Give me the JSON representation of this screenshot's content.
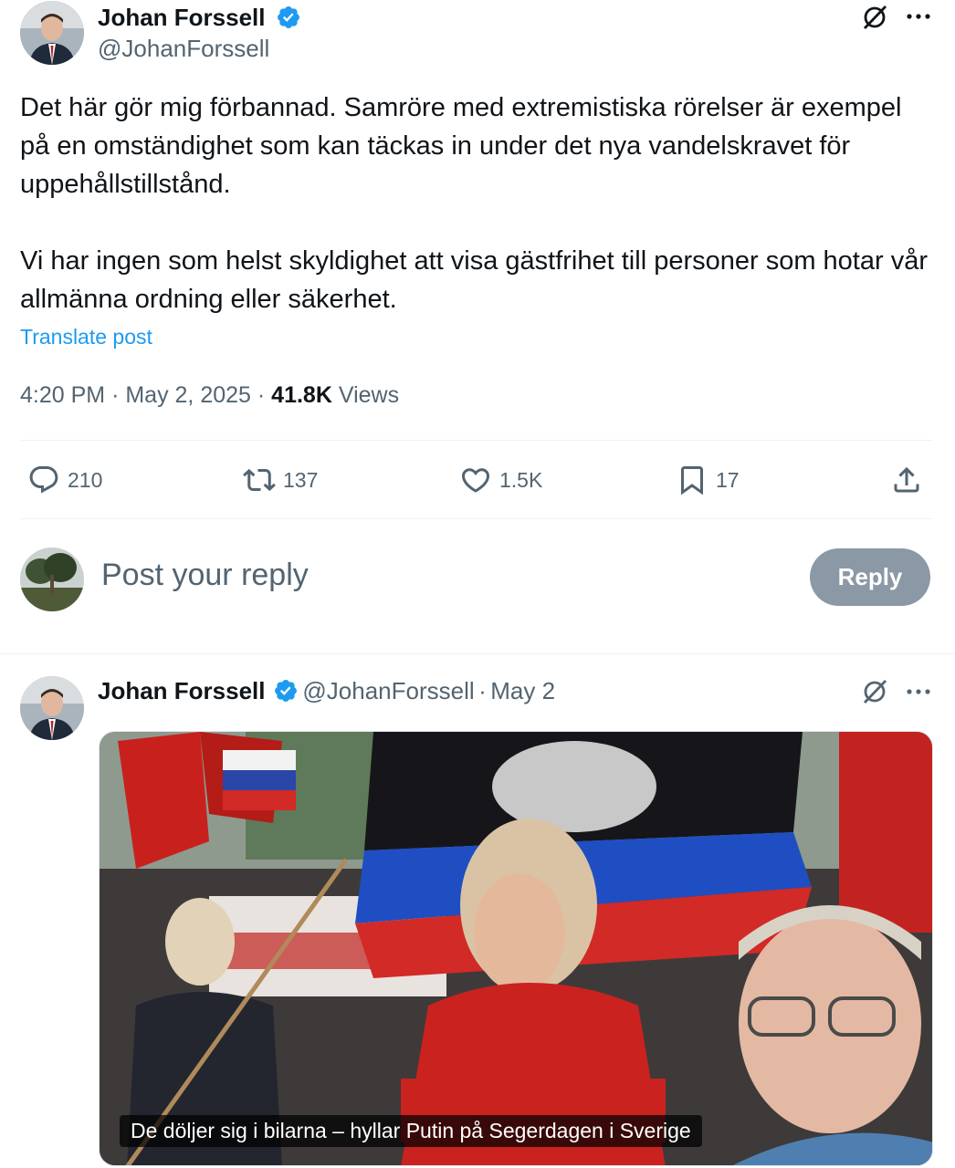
{
  "main_post": {
    "author_name": "Johan Forssell",
    "author_handle": "@JohanForssell",
    "text": "Det här gör mig förbannad. Samröre med extremistiska rörelser är exempel på en omständighet som kan täckas in under det nya vandelskravet för uppehållstillstånd.\n\nVi har ingen som helst skyldighet att visa gästfrihet till personer som hotar vår allmänna ordning eller säkerhet.",
    "translate_label": "Translate post",
    "time": "4:20 PM",
    "date": "May 2, 2025",
    "views_count": "41.8K",
    "views_label": "Views",
    "actions": {
      "replies": "210",
      "reposts": "137",
      "likes": "1.5K",
      "bookmarks": "17"
    }
  },
  "reply_box": {
    "placeholder": "Post your reply",
    "button_label": "Reply"
  },
  "quoted_post": {
    "author_name": "Johan Forssell",
    "author_handle": "@JohanForssell",
    "separator": "·",
    "date": "May 2",
    "media_caption": "De döljer sig i bilarna – hyllar Putin på Segerdagen i Sverige"
  },
  "colors": {
    "link": "#1d9bf0",
    "verified": "#1d9bf0",
    "secondary_text": "#536471",
    "reply_button_disabled": "#8b98a5"
  },
  "icons": [
    "grok-icon",
    "more-icon",
    "reply-icon",
    "repost-icon",
    "like-icon",
    "bookmark-icon",
    "share-icon",
    "verified-badge-icon"
  ]
}
